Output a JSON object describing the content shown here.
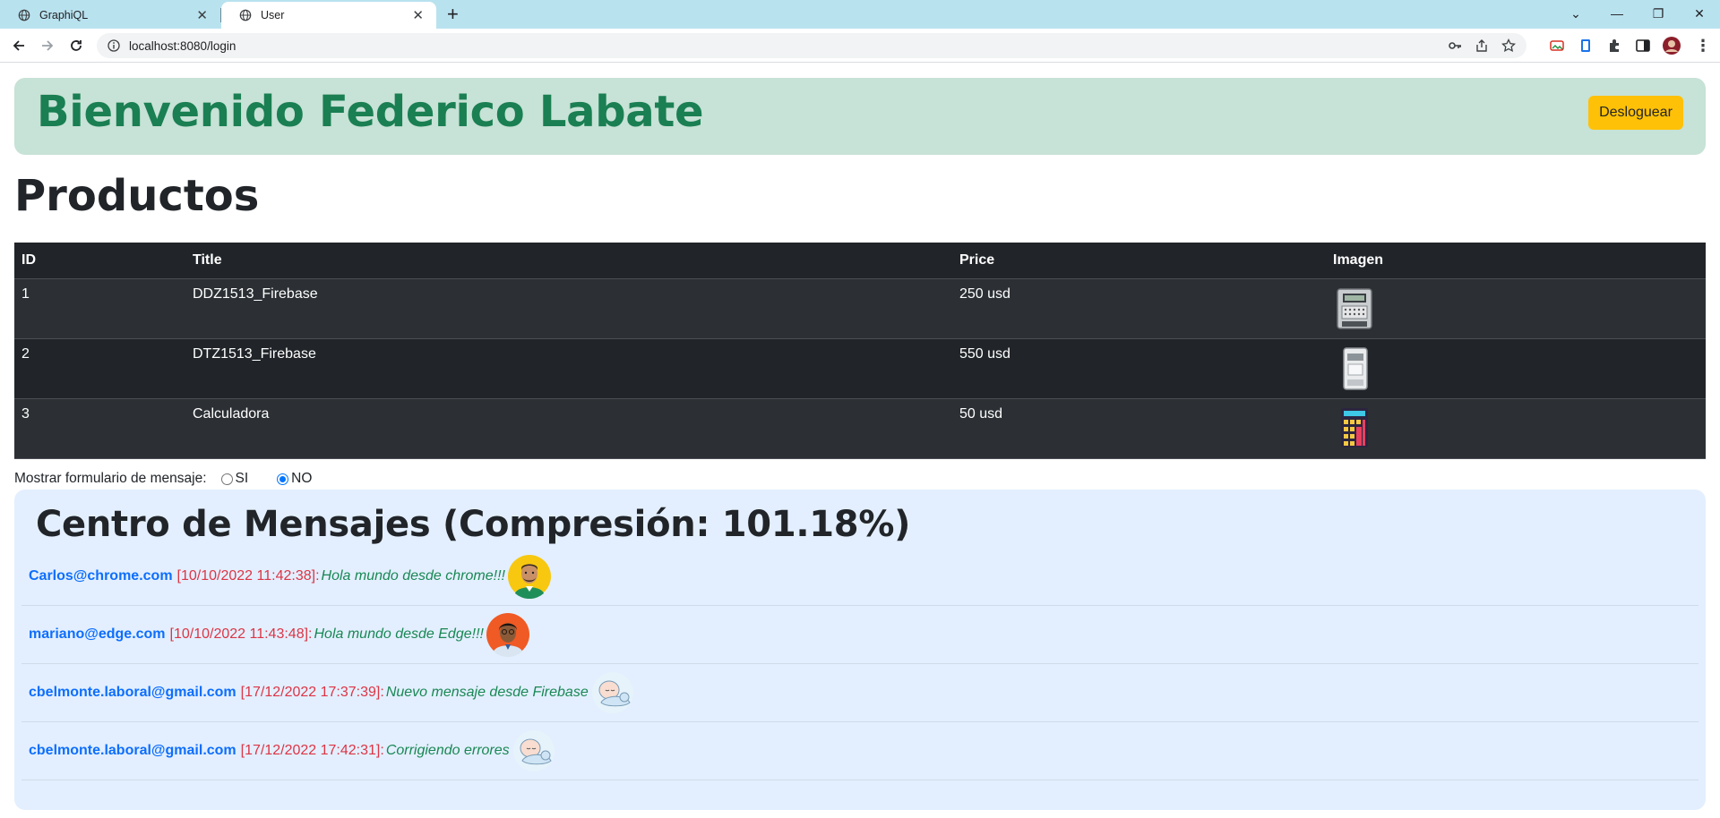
{
  "browser": {
    "tabs": [
      {
        "title": "GraphiQL",
        "active": false
      },
      {
        "title": "User",
        "active": true
      }
    ],
    "url": "localhost:8080/login"
  },
  "header": {
    "welcome": "Bienvenido Federico Labate",
    "logout_label": "Desloguear"
  },
  "products": {
    "title": "Productos",
    "columns": [
      "ID",
      "Title",
      "Price",
      "Imagen"
    ],
    "rows": [
      {
        "id": "1",
        "title": "DDZ1513_Firebase",
        "price": "250 usd",
        "image": "meter-icon"
      },
      {
        "id": "2",
        "title": "DTZ1513_Firebase",
        "price": "550 usd",
        "image": "meter-small-icon"
      },
      {
        "id": "3",
        "title": "Calculadora",
        "price": "50 usd",
        "image": "calculator-icon"
      }
    ]
  },
  "message_form_toggle": {
    "label": "Mostrar formulario de mensaje:",
    "options": [
      "SI",
      "NO"
    ],
    "selected": "NO"
  },
  "messages": {
    "title": "Centro de Mensajes (Compresión: 101.18%)",
    "items": [
      {
        "email": "Carlos@chrome.com",
        "date": "[10/10/2022 11:42:38]",
        "text": "Hola mundo desde chrome!!!",
        "avatar": "man-yellow-avatar"
      },
      {
        "email": "mariano@edge.com",
        "date": "[10/10/2022 11:43:48]",
        "text": "Hola mundo desde Edge!!!",
        "avatar": "man-orange-avatar"
      },
      {
        "email": "cbelmonte.laboral@gmail.com",
        "date": "[17/12/2022 17:37:39]",
        "text": "Nuevo mensaje desde Firebase",
        "avatar": "baby-avatar"
      },
      {
        "email": "cbelmonte.laboral@gmail.com",
        "date": "[17/12/2022 17:42:31]",
        "text": "Corrigiendo errores",
        "avatar": "baby-avatar"
      }
    ]
  },
  "colors": {
    "tabbar": "#b9e2ef",
    "welcome_bg": "#c7e2d6",
    "welcome_text": "#1a7f52",
    "logout_button": "#ffc107",
    "table_bg": "#212529",
    "messages_bg": "#e3efff",
    "email": "#0d6efd",
    "date": "#dc3545",
    "message_text": "#198754"
  }
}
